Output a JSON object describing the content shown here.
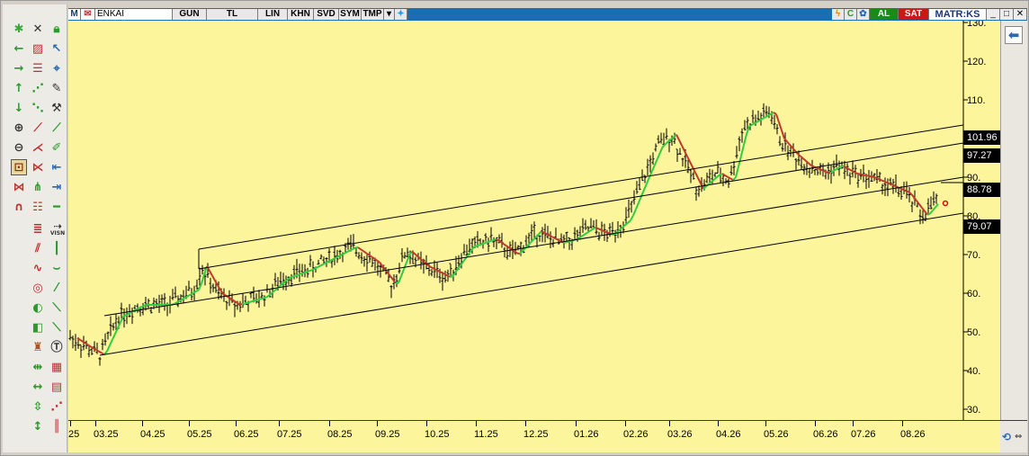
{
  "topbar": {
    "symbol": "ENKAI",
    "period": "GUN",
    "currency": "TL",
    "scale": "LIN",
    "btn_khn": "KHN",
    "btn_svd": "SVD",
    "btn_sym": "SYM",
    "btn_tmp": "TMP",
    "buy": "AL",
    "sell": "SAT",
    "logo": "MATR:KS",
    "m_label": "M"
  },
  "toolbar": {
    "vision_label": "VISN"
  },
  "y_axis": {
    "ticks": [
      "30.",
      "40.",
      "50.",
      "60.",
      "70.",
      "80.",
      "90.",
      "110.",
      "120.",
      "130."
    ]
  },
  "x_axis": {
    "ticks": [
      "25",
      "03.25",
      "04.25",
      "05.25",
      "06.25",
      "07.25",
      "08.25",
      "09.25",
      "10.25",
      "11.25",
      "12.25",
      "01.26",
      "02.26",
      "03.26",
      "04.26",
      "05.26",
      "06.26",
      "07.26",
      "08.26"
    ]
  },
  "price_boxes": [
    "101.96",
    "97.27",
    "88.78",
    "79.07"
  ],
  "colors": {
    "chart_bg": "#fcf59c",
    "ma_up": "#2ecc40",
    "ma_down": "#c0392b",
    "titlebar": "#1a6fb0"
  }
}
